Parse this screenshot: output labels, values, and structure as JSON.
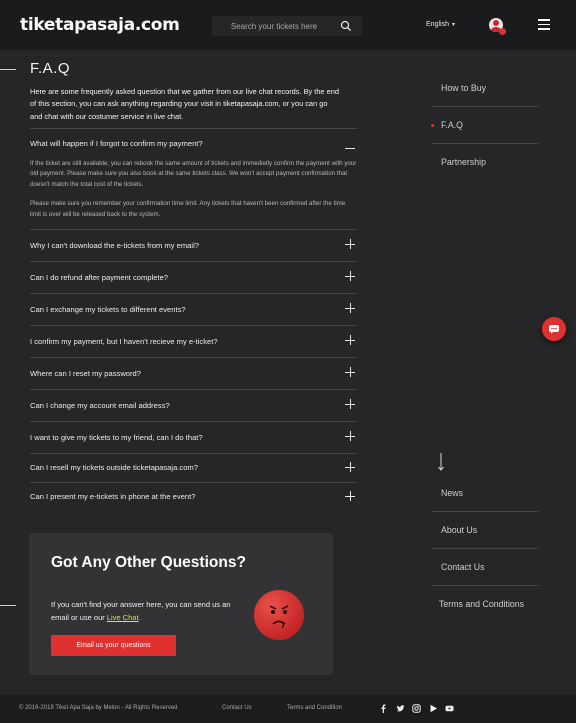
{
  "header": {
    "logo": "tiketapasaja.com",
    "search_placeholder": "Search your tickets here",
    "language": "English",
    "caret": "▾"
  },
  "faq": {
    "title": "F.A.Q",
    "intro": "Here are some frequently asked question that we gather from our live chat records. By the end of this section, you can ask anything regarding your visit in tiketapasaja.com, or you can go and chat with our costumer service in live chat.",
    "open_item": {
      "question": "What will happen if I forgot to confirm my payment?",
      "answer_1": "If the ticket are still available, you can rebook the same amount of tickets and immedietly confirm the payment with your old payment. Please make sure you also book at the same tickets class. We won't accept payment confirmation that doesn't match the total cost of the tickets.",
      "answer_2": "Please make sure you remember your confirmation time limit. Any tickets that haven't been confirmed after the time limit is over will be released back to the system."
    },
    "items": [
      "Why I can't download the e-tickets from my email?",
      "Can I do refund after payment complete?",
      "Can I exchange my tickets to different events?",
      "I confirm my payment, but I haven't recieve my e-ticket?",
      "Where can I reset my password?",
      "Can I change my account email address?",
      "I want to give my tickets to my friend, can I do that?",
      "Can I resell my tickets outside ticketapasaja.com?",
      "Can I present my e-tickets in phone at the event?"
    ]
  },
  "right_nav_top": [
    "How to Buy",
    "F.A.Q",
    "Partnership"
  ],
  "right_nav_bottom": [
    "News",
    "About Us",
    "Contact Us",
    "Terms and Conditions"
  ],
  "contact": {
    "title": "Got Any Other Questions?",
    "text_before": "If you can't find your answer here, you can send us an email or use our ",
    "link": "Live Chat",
    "text_after": ".",
    "button": "Email us your questions"
  },
  "footer": {
    "copyright": "© 2016-2019 Tiket Apa Saja by Melon - All Rights Reserved",
    "contact": "Contact Us",
    "terms": "Terms and Condition"
  },
  "colors": {
    "background": "#262628",
    "header": "#1b1b1d",
    "accent": "#e0302f",
    "link": "#e8df3a",
    "card": "#333335"
  },
  "icons": [
    "search-icon",
    "caret-down-icon",
    "user-avatar-icon",
    "hamburger-menu-icon",
    "plus-icon",
    "minus-icon",
    "arrow-down-icon",
    "chat-icon",
    "sad-face-icon",
    "facebook-icon",
    "twitter-icon",
    "instagram-icon",
    "play-store-icon",
    "youtube-icon"
  ]
}
